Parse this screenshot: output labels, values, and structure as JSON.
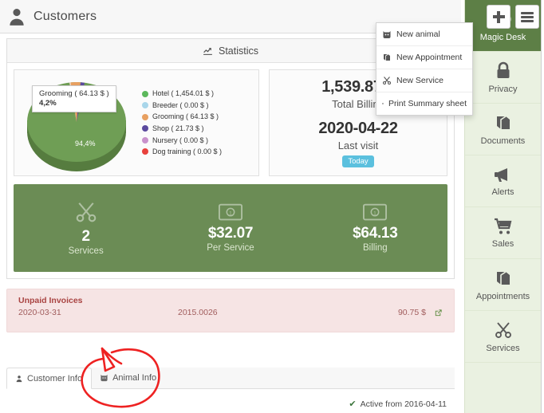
{
  "header": {
    "title": "Customers",
    "icon": "person-icon",
    "add_button": "+",
    "menu_button": "menu"
  },
  "dropdown": {
    "items": [
      {
        "label": "New animal",
        "icon": "animal-icon"
      },
      {
        "label": "New Appointment",
        "icon": "book-icon"
      },
      {
        "label": "New Service",
        "icon": "scissors-icon"
      },
      {
        "label": "Print Summary sheet",
        "icon": "printer-icon"
      }
    ]
  },
  "statistics": {
    "panel_title": "Statistics",
    "panel_icon": "chart-line-icon",
    "tooltip": {
      "label": "Grooming ( 64.13 $ )",
      "percent": "4,2%"
    },
    "main_slice_label": "94,4%",
    "billing": {
      "total_value": "1,539.87 $",
      "total_label": "Total Billing",
      "last_visit_value": "2020-04-22",
      "last_visit_label": "Last visit",
      "badge": "Today"
    }
  },
  "chart_data": {
    "type": "pie",
    "title": "Statistics",
    "categories": [
      "Hotel",
      "Breeder",
      "Grooming",
      "Shop",
      "Nursery",
      "Dog training"
    ],
    "values": [
      1454.01,
      0.0,
      64.13,
      21.73,
      0.0,
      0.0
    ],
    "percents": [
      94.4,
      0.0,
      4.2,
      1.4,
      0.0,
      0.0
    ],
    "colors": [
      "#5cb85c",
      "#a9d6ea",
      "#e8a061",
      "#5b4a9e",
      "#c992cc",
      "#e8413d"
    ],
    "legend": [
      "Hotel ( 1,454.01 $ )",
      "Breeder ( 0.00 $ )",
      "Grooming ( 64.13 $ )",
      "Shop ( 21.73 $ )",
      "Nursery ( 0.00 $ )",
      "Dog training ( 0.00 $ )"
    ],
    "legend_position": "right",
    "data_labels": [
      "94,4%",
      "4,2%"
    ],
    "currency": "$"
  },
  "kpi": {
    "items": [
      {
        "icon": "scissors-icon",
        "value": "2",
        "label": "Services"
      },
      {
        "icon": "money-icon",
        "value": "$32.07",
        "label": "Per Service"
      },
      {
        "icon": "money-icon",
        "value": "$64.13",
        "label": "Billing"
      }
    ],
    "bg_color": "#6b8c55"
  },
  "unpaid": {
    "title": "Unpaid Invoices",
    "rows": [
      {
        "date": "2020-03-31",
        "reference": "2015.0026",
        "amount": "90.75 $",
        "link_icon": "external-link-icon"
      }
    ],
    "bg_color": "#f6e4e4",
    "text_color": "#a94442"
  },
  "tabs": {
    "items": [
      {
        "label": "Customer Info",
        "icon": "person-icon",
        "active": true
      },
      {
        "label": "Animal Info",
        "icon": "animal-icon",
        "active": false
      }
    ],
    "status": "Active from 2016-04-11",
    "status_icon": "check-icon"
  },
  "sidebar": {
    "items": [
      {
        "label": "Magic Desk",
        "icon": "dashboard-icon",
        "active": true
      },
      {
        "label": "Privacy",
        "icon": "lock-icon",
        "active": false
      },
      {
        "label": "Documents",
        "icon": "book-icon",
        "active": false
      },
      {
        "label": "Alerts",
        "icon": "megaphone-icon",
        "active": false
      },
      {
        "label": "Sales",
        "icon": "cart-icon",
        "active": false
      },
      {
        "label": "Appointments",
        "icon": "book-icon",
        "active": false
      },
      {
        "label": "Services",
        "icon": "scissors-icon",
        "active": false
      }
    ],
    "active_color": "#5d7f46",
    "bg_color": "#eaf1e1"
  },
  "annotation": {
    "shape": "red-circle-arrow",
    "color": "#ee2222",
    "target": "Animal Info"
  }
}
